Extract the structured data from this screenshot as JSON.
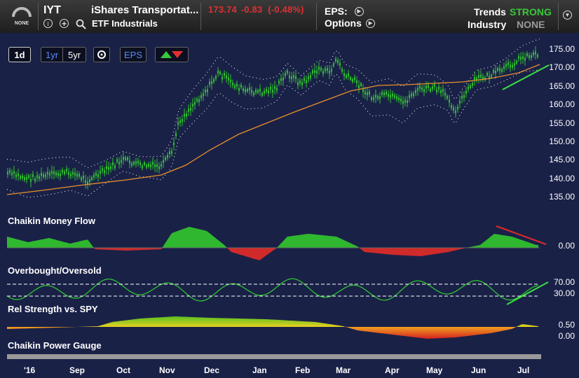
{
  "header": {
    "rating_label": "NONE",
    "ticker": "IYT",
    "name": "iShares Transportat...",
    "price": "173.74",
    "change": "-0.83",
    "change_pct": "(-0.48%)",
    "sector": "ETF Industrials",
    "eps_label": "EPS:",
    "options_label": "Options",
    "trends_label": "Trends",
    "trends_value": "STRONG",
    "industry_label": "Industry",
    "industry_value": "NONE",
    "colors": {
      "strong": "#38c83a",
      "none": "#9a9a9a",
      "negative": "#e03030"
    }
  },
  "toolbar": {
    "btn_1d": "1d",
    "btn_1yr": "1yr",
    "btn_5yr": "5yr",
    "btn_eps": "EPS"
  },
  "price_axis": [
    "175.00",
    "170.00",
    "165.00",
    "160.00",
    "155.00",
    "150.00",
    "145.00",
    "140.00",
    "135.00"
  ],
  "panels": {
    "cmf_label": "Chaikin Money Flow",
    "cmf_axis": "0.00",
    "obos_label": "Overbought/Oversold",
    "obos_axis_high": "70.00",
    "obos_axis_low": "30.00",
    "rs_label": "Rel Strength vs. SPY",
    "rs_axis_high": "0.50",
    "rs_axis_low": "0.00",
    "pg_label": "Chaikin Power Gauge"
  },
  "x_axis": [
    "'16",
    "Sep",
    "Oct",
    "Nov",
    "Dec",
    "Jan",
    "Feb",
    "Mar",
    "Apr",
    "May",
    "Jun",
    "Jul"
  ]
}
